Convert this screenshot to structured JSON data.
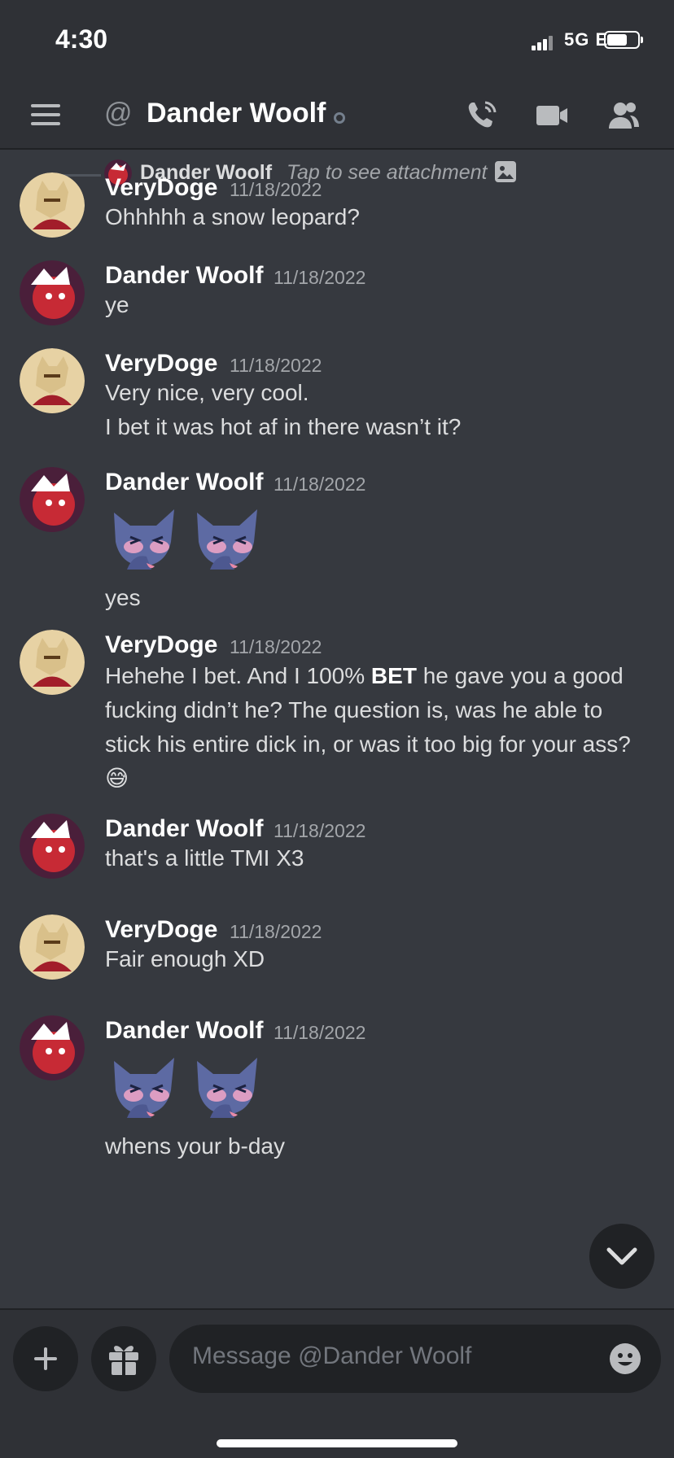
{
  "status_bar": {
    "time": "4:30",
    "network": "5G E"
  },
  "header": {
    "at_symbol": "@",
    "title": "Dander Woolf"
  },
  "reply_preview": {
    "author": "Dander Woolf",
    "text": "Tap to see attachment"
  },
  "messages": [
    {
      "author": "VeryDoge",
      "timestamp": "11/18/2022",
      "lines": [
        "Ohhhhh a snow leopard?"
      ]
    },
    {
      "author": "Dander Woolf",
      "timestamp": "11/18/2022",
      "lines": [
        "ye"
      ]
    },
    {
      "author": "VeryDoge",
      "timestamp": "11/18/2022",
      "lines": [
        "Very nice, very cool.",
        "I bet it was hot af in there wasn’t it?"
      ]
    },
    {
      "author": "Dander Woolf",
      "timestamp": "11/18/2022",
      "text": "yes"
    },
    {
      "author": "VeryDoge",
      "timestamp": "11/18/2022",
      "text_before": "Hehehe I bet. And I 100% ",
      "bold": "BET",
      "text_after": " he gave you a good fucking didn’t he? The question is, was he able to stick his entire dick in, or was it too big for your ass? 😅"
    },
    {
      "author": "Dander Woolf",
      "timestamp": "11/18/2022",
      "lines": [
        "that's a little TMI X3"
      ]
    },
    {
      "author": "VeryDoge",
      "timestamp": "11/18/2022",
      "lines": [
        "Fair enough XD"
      ]
    },
    {
      "author": "Dander Woolf",
      "timestamp": "11/18/2022",
      "text": "whens your b-day"
    }
  ],
  "composer": {
    "placeholder": "Message @Dander Woolf"
  },
  "icons": [
    "hamburger-icon",
    "call-icon",
    "video-icon",
    "members-icon",
    "image-icon",
    "chevron-down-icon",
    "plus-icon",
    "gift-icon",
    "emoji-icon"
  ],
  "colors": {
    "background": "#36393f",
    "header": "#2f3136",
    "input": "#202225"
  }
}
